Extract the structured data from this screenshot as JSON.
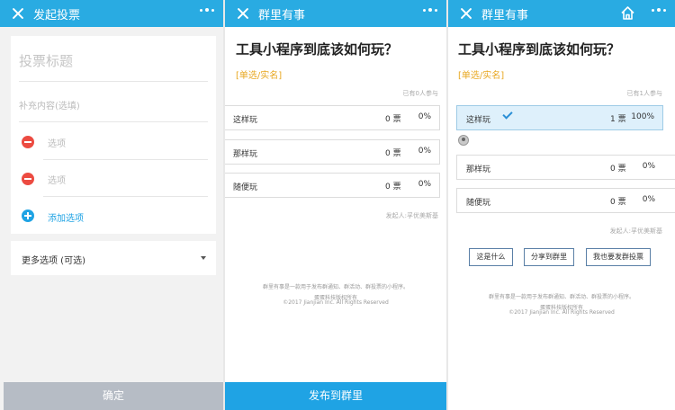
{
  "panel1": {
    "topbar": {
      "title": "发起投票"
    },
    "title_placeholder": "投票标题",
    "extra_placeholder": "补充内容(选填)",
    "options": [
      {
        "placeholder": "选项"
      },
      {
        "placeholder": "选项"
      }
    ],
    "add_option": "添加选项",
    "more_options": "更多选项 (可选)",
    "confirm": "确定"
  },
  "panel2": {
    "topbar": {
      "title": "群里有事"
    },
    "question": "工具小程序到底该如何玩？",
    "tag": "[单选/实名]",
    "participants": "已有0人参与",
    "options": [
      {
        "label": "这样玩",
        "count": "0 票",
        "percent": "0%"
      },
      {
        "label": "那样玩",
        "count": "0 票",
        "percent": "0%"
      },
      {
        "label": "随便玩",
        "count": "0 票",
        "percent": "0%"
      }
    ],
    "initiator": "发起人:孚优美斯基",
    "footer_desc": "群里有事是一款用于发布群通知、群活动、群投票的小程序。",
    "footer_company": "蛋蛋科技版权所有",
    "footer_copy": "©2017 Jianjian Inc. All Rights Reserved",
    "publish": "发布到群里"
  },
  "panel3": {
    "topbar": {
      "title": "群里有事"
    },
    "question": "工具小程序到底该如何玩？",
    "tag": "[单选/实名]",
    "participants": "已有1人参与",
    "options": [
      {
        "label": "这样玩",
        "count": "1 票",
        "percent": "100%",
        "selected": true
      },
      {
        "label": "那样玩",
        "count": "0 票",
        "percent": "0%"
      },
      {
        "label": "随便玩",
        "count": "0 票",
        "percent": "0%"
      }
    ],
    "initiator": "发起人:孚优美斯基",
    "buttons": {
      "what": "这是什么",
      "share": "分享到群里",
      "create": "我也要发群投票"
    },
    "footer_desc": "群里有事是一款用于发布群通知、群活动、群投票的小程序。",
    "footer_company": "蛋蛋科技版权所有",
    "footer_copy": "©2017 Jianjian Inc. All Rights Reserved"
  },
  "colors": {
    "topbar": "#29abe2",
    "primary": "#1fa3e4",
    "danger": "#ec4b41",
    "tag": "#e8a822",
    "confirm_disabled": "#b6bcc5"
  },
  "icons": [
    "close-icon",
    "more-icon",
    "home-icon",
    "remove-option-icon",
    "add-option-icon",
    "chevron-down-icon",
    "check-icon",
    "avatar"
  ]
}
